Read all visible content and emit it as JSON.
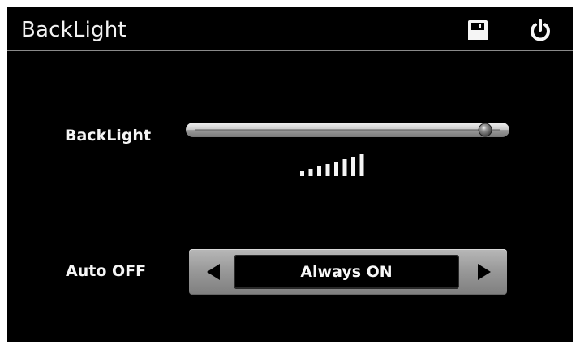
{
  "window": {
    "title": "BackLight",
    "icons": {
      "save": "save-icon",
      "power": "power-icon"
    }
  },
  "settings": {
    "backlight": {
      "label": "BackLight",
      "level_fraction": 0.95,
      "indicator_bars": 8
    },
    "auto_off": {
      "label": "Auto OFF",
      "value": "Always ON",
      "icons": {
        "previous": "left-arrow-icon",
        "next": "right-arrow-icon"
      }
    }
  },
  "colors": {
    "background": "#000000",
    "text": "#f5f5f5",
    "selector_gray": "#9a9a9a"
  }
}
